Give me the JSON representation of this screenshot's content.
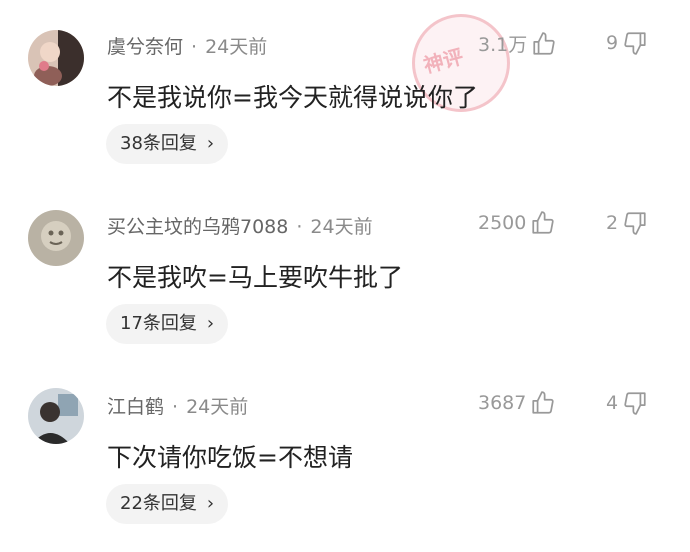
{
  "watermark": {
    "text": "神评"
  },
  "comments": [
    {
      "username": "虞兮奈何",
      "time": "24天前",
      "text": "不是我说你=我今天就得说说你了",
      "replies": "38条回复",
      "likes": "3.1万",
      "dislikes": "9"
    },
    {
      "username": "买公主坟的乌鸦7088",
      "time": "24天前",
      "text": "不是我吹=马上要吹牛批了",
      "replies": "17条回复",
      "likes": "2500",
      "dislikes": "2"
    },
    {
      "username": "江白鹤",
      "time": "24天前",
      "text": "下次请你吃饭=不想请",
      "replies": "22条回复",
      "likes": "3687",
      "dislikes": "4"
    }
  ],
  "icons": {
    "like": "thumbs-up-icon",
    "dislike": "thumbs-down-icon",
    "chevron": "chevron-right-icon"
  },
  "colors": {
    "text": "#222222",
    "meta": "#8a8a8a",
    "reply_pill": "#f3f3f3"
  }
}
